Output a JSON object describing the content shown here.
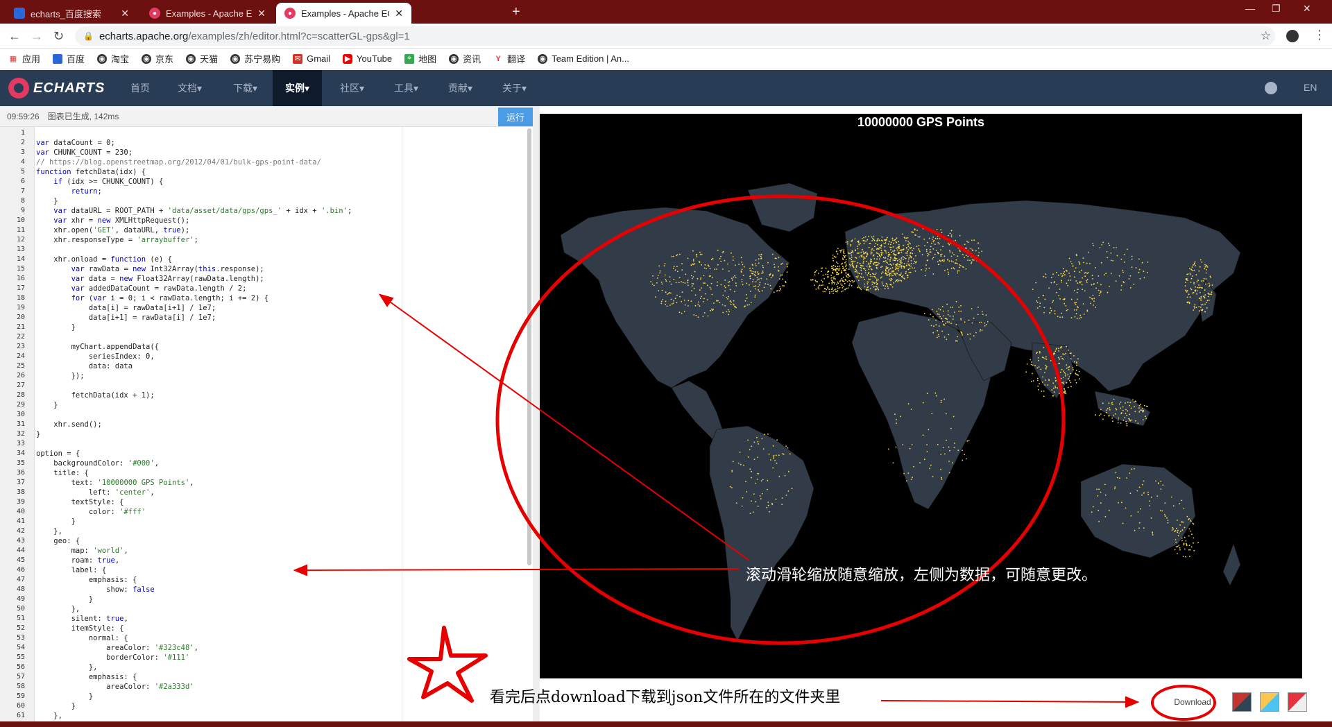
{
  "tabs": [
    {
      "title": "echarts_百度搜索",
      "icon": "baidu-paw-icon"
    },
    {
      "title": "Examples - Apache ECharts (in",
      "icon": "echarts-logo-icon"
    },
    {
      "title": "Examples - Apache ECharts (in",
      "icon": "echarts-logo-icon"
    }
  ],
  "active_tab": 2,
  "window_controls": [
    "—",
    "❐",
    "✕"
  ],
  "address": {
    "host": "echarts.apache.org",
    "path": "/examples/zh/editor.html?c=scatterGL-gps&gl=1"
  },
  "bookmarks": [
    "应用",
    "百度",
    "淘宝",
    "京东",
    "天猫",
    "苏宁易购",
    "Gmail",
    "YouTube",
    "地图",
    "资讯",
    "翻译",
    "Team Edition | An..."
  ],
  "ecnav": {
    "logo": "ECHARTS",
    "items": [
      "首页",
      "文档▾",
      "下载▾",
      "实例▾",
      "社区▾",
      "工具▾",
      "贡献▾",
      "关于▾"
    ],
    "active_index": 3,
    "lang": "EN"
  },
  "editor": {
    "timestamp": "09:59:26",
    "status": "图表已生成, 142ms",
    "run_label": "运行",
    "lines": [
      "",
      "var dataCount = 0;",
      "var CHUNK_COUNT = 230;",
      "// https://blog.openstreetmap.org/2012/04/01/bulk-gps-point-data/",
      "function fetchData(idx) {",
      "    if (idx >= CHUNK_COUNT) {",
      "        return;",
      "    }",
      "    var dataURL = ROOT_PATH + 'data/asset/data/gps/gps_' + idx + '.bin';",
      "    var xhr = new XMLHttpRequest();",
      "    xhr.open('GET', dataURL, true);",
      "    xhr.responseType = 'arraybuffer';",
      "",
      "    xhr.onload = function (e) {",
      "        var rawData = new Int32Array(this.response);",
      "        var data = new Float32Array(rawData.length);",
      "        var addedDataCount = rawData.length / 2;",
      "        for (var i = 0; i < rawData.length; i += 2) {",
      "            data[i] = rawData[i+1] / 1e7;",
      "            data[i+1] = rawData[i] / 1e7;",
      "        }",
      "",
      "        myChart.appendData({",
      "            seriesIndex: 0,",
      "            data: data",
      "        });",
      "",
      "        fetchData(idx + 1);",
      "    }",
      "",
      "    xhr.send();",
      "}",
      "",
      "option = {",
      "    backgroundColor: '#000',",
      "    title: {",
      "        text: '10000000 GPS Points',",
      "            left: 'center',",
      "        textStyle: {",
      "            color: '#fff'",
      "        }",
      "    },",
      "    geo: {",
      "        map: 'world',",
      "        roam: true,",
      "        label: {",
      "            emphasis: {",
      "                show: false",
      "            }",
      "        },",
      "        silent: true,",
      "        itemStyle: {",
      "            normal: {",
      "                areaColor: '#323c48',",
      "                borderColor: '#111'",
      "            },",
      "            emphasis: {",
      "                areaColor: '#2a333d'",
      "            }",
      "        }",
      "    },"
    ]
  },
  "chart": {
    "title": "10000000 GPS Points",
    "background": "#000000",
    "land_color": "#323c48",
    "point_color": "#ffdd44"
  },
  "toolbar": {
    "download_label": "Download"
  },
  "annotations": {
    "zoom_note": "滚动滑轮缩放随意缩放，左侧为数据，可随意更改。",
    "download_note": "看完后点download下载到json文件所在的文件夹里",
    "color": "#e60000"
  }
}
